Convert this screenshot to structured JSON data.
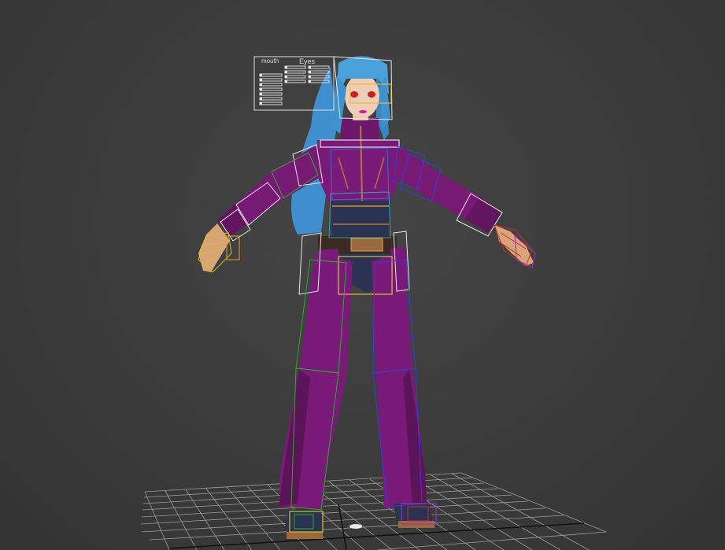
{
  "viewport": {
    "colors": {
      "background": "#3c3c3c",
      "grid": "#cfcfcf",
      "suit": "#7a1a78",
      "hair": "#4aa0d8",
      "rig_left": "#2ea82e",
      "rig_right": "#3a3ad8",
      "rig_box": "#f0f0f0",
      "rig_hand_l": "#d8c020",
      "rig_hand_r": "#d02a2a"
    }
  },
  "facial_panel": {
    "mouth_label": "mouth",
    "eyes_label": "Eyes"
  }
}
